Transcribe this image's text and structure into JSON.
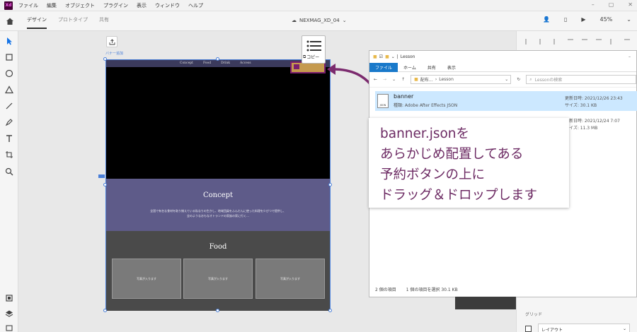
{
  "app": {
    "logo": "Xd",
    "menu": [
      "ファイル",
      "編集",
      "オブジェクト",
      "プラグイン",
      "表示",
      "ウィンドウ",
      "ヘルプ"
    ],
    "document_title": "NEXMAG_XD_04",
    "modes": [
      "デザイン",
      "プロトタイプ",
      "共有"
    ],
    "zoom": "45%"
  },
  "artboard": {
    "label": "バナー追加",
    "nav_links": [
      "Concept",
      "Food",
      "Drink",
      "Access"
    ],
    "concept_title": "Concept",
    "concept_text_1": "全国で有名な食材を取り揃えている私なりの生かし、地域団員をふんだんに使った料理を少びつで提供し、",
    "concept_text_2": "全のようなおもなオトランドの家族の家に行く…",
    "food_title": "Food",
    "photo_label": "写真が入ります"
  },
  "drag": {
    "copy_label": "コピー"
  },
  "explorer": {
    "title": "Lesson",
    "ribbon_tabs": [
      "ファイル",
      "ホーム",
      "共有",
      "表示"
    ],
    "address": [
      "配布…",
      "Lesson"
    ],
    "search_placeholder": "Lessonの検索",
    "files": [
      {
        "name": "banner",
        "type": "種類: Adobe After Effects JSON",
        "modified": "更新日時: 2021/12/26 23:43",
        "size": "サイズ: 30.1 KB"
      },
      {
        "modified": "更新日時: 2021/12/24 7:07",
        "size": "サイズ: 11.3 MB"
      }
    ],
    "status_count": "2 個の項目",
    "status_selected": "1 個の項目を選択  30.1 KB"
  },
  "callout": {
    "lines": [
      "banner.jsonを",
      "あらかじめ配置してある",
      "予約ボタンの上に",
      "ドラッグ＆ドロップします"
    ]
  },
  "right_panel": {
    "grid_label": "グリッド",
    "layout_label": "レイアウト"
  }
}
